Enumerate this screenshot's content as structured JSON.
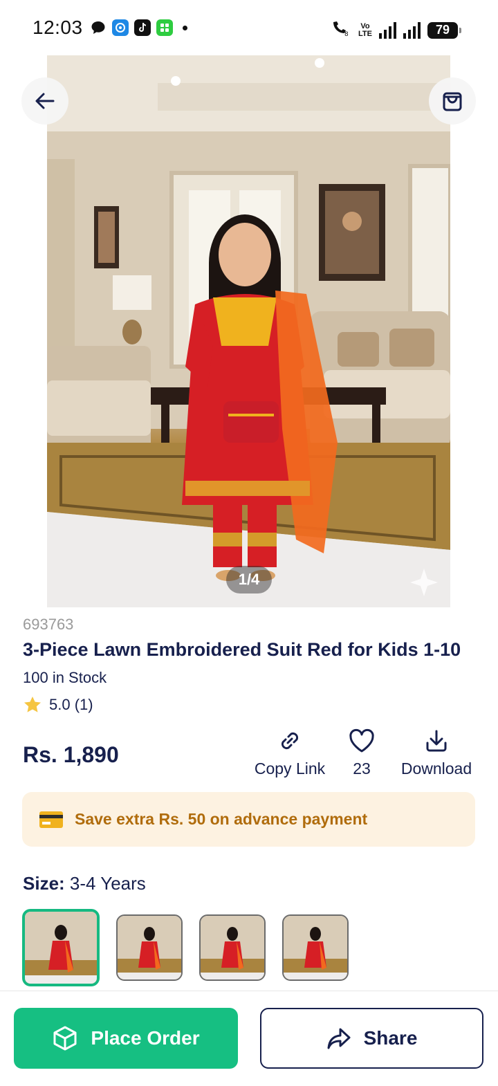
{
  "status_bar": {
    "time": "12:03",
    "battery": "79",
    "network_label": "Vo LTE"
  },
  "product": {
    "image_counter": "1/4",
    "sku": "693763",
    "title": "3-Piece Lawn Embroidered Suit Red for Kids 1-10",
    "stock": "100 in Stock",
    "rating": "5.0 (1)",
    "price": "Rs. 1,890"
  },
  "actions": {
    "copy_link": "Copy Link",
    "likes": "23",
    "download": "Download"
  },
  "promo": {
    "text": "Save extra Rs. 50 on advance payment"
  },
  "size": {
    "label": "Size:",
    "value": "3-4 Years"
  },
  "buttons": {
    "place_order": "Place Order",
    "share": "Share"
  },
  "icons": [
    "back-arrow-icon",
    "shopping-bag-icon",
    "link-icon",
    "heart-icon",
    "download-icon",
    "card-icon",
    "box-icon",
    "share-icon",
    "star-icon"
  ],
  "colors": {
    "primary_text": "#17204d",
    "accent_green": "#16bf82",
    "promo_bg": "#fdf2e1",
    "promo_text": "#b06c0c",
    "star": "#f5c542"
  }
}
